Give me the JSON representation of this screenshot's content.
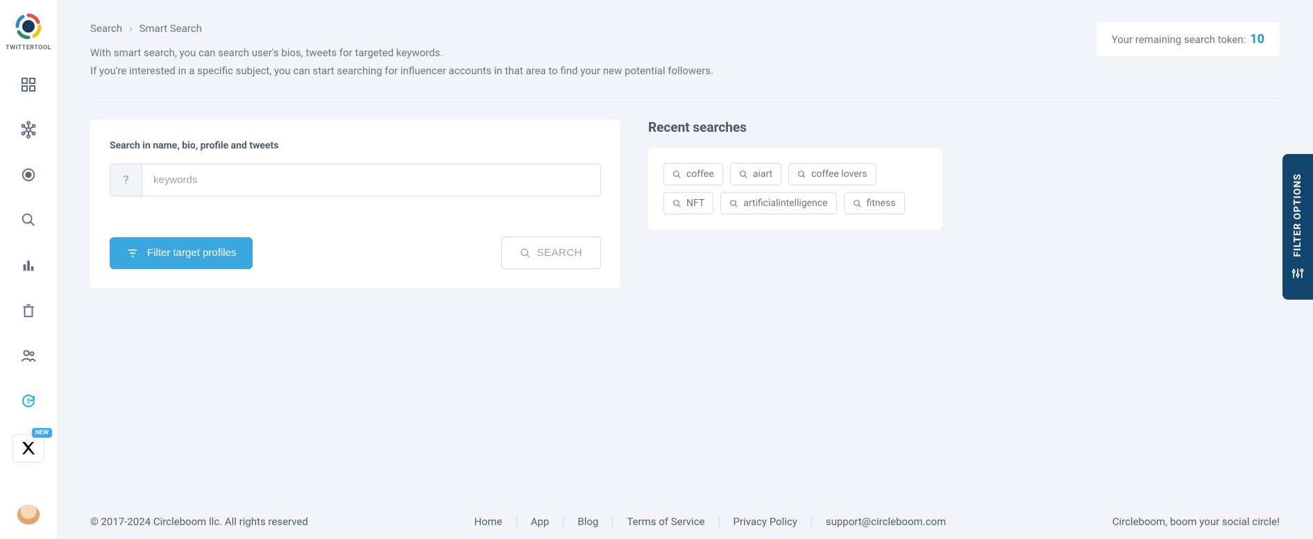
{
  "logo": {
    "text": "TWITTERTOOL"
  },
  "sidebar": {
    "new_badge": "NEW"
  },
  "breadcrumb": {
    "root": "Search",
    "current": "Smart Search"
  },
  "description": {
    "line1": "With smart search, you can search user's bios, tweets for targeted keywords.",
    "line2": "If you're interested in a specific subject, you can start searching for influencer accounts in that area to find your new potential followers."
  },
  "token": {
    "label": "Your remaining search token:",
    "value": "10"
  },
  "search_card": {
    "title": "Search in name, bio, profile and tweets",
    "placeholder": "keywords",
    "filter_btn": "Filter target profiles",
    "search_btn": "SEARCH"
  },
  "recent": {
    "title": "Recent searches",
    "items": [
      "coffee",
      "aiart",
      "coffee lovers",
      "NFT",
      "artificialintelligence",
      "fitness"
    ]
  },
  "side_tab": {
    "label": "FILTER OPTIONS"
  },
  "footer": {
    "copyright": "© 2017-2024 Circleboom llc. All rights reserved",
    "links": [
      "Home",
      "App",
      "Blog",
      "Terms of Service",
      "Privacy Policy",
      "support@circleboom.com"
    ],
    "tagline": "Circleboom, boom your social circle!"
  }
}
